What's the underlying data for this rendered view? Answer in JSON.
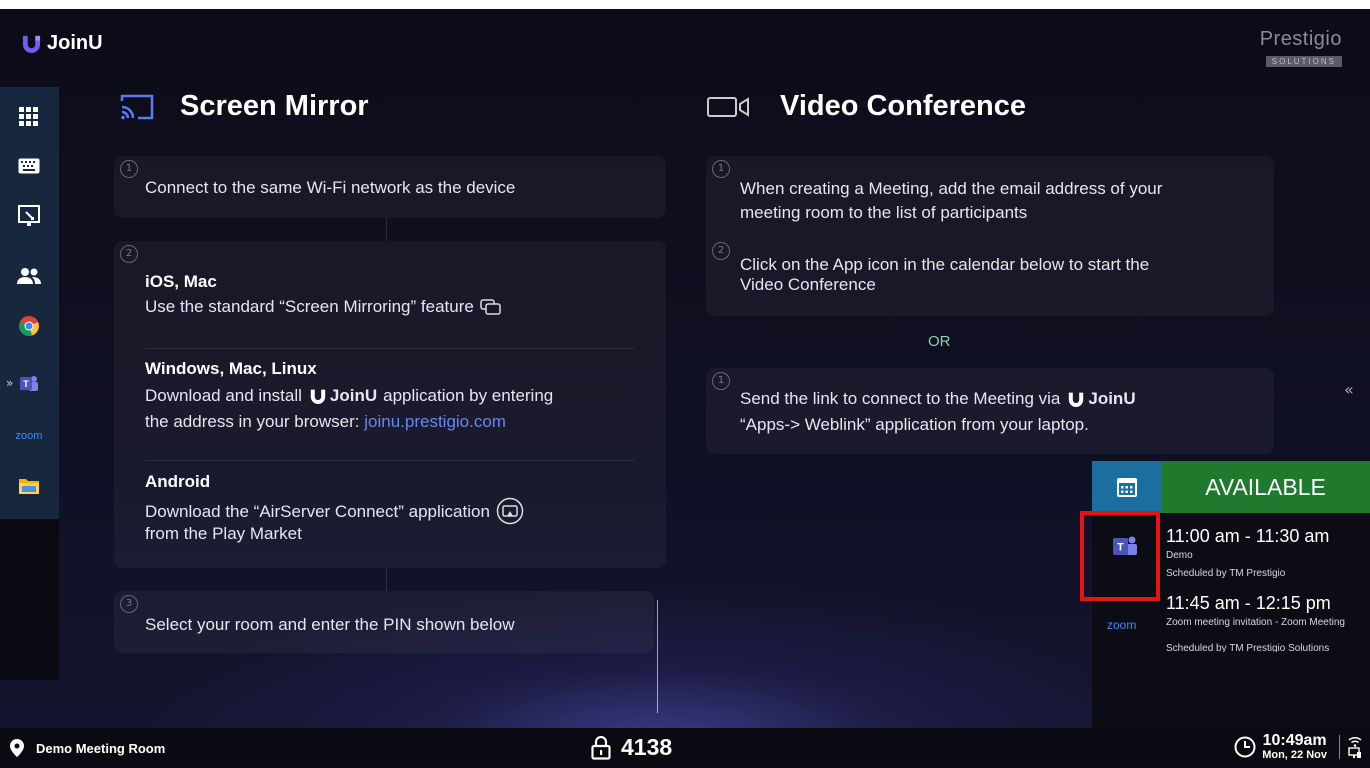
{
  "app": {
    "name": "JoinU"
  },
  "brand": {
    "line1": "Prestigio",
    "line2": "SOLUTIONS"
  },
  "sidebar": {
    "items": [
      {
        "icon": "apps-grid-icon"
      },
      {
        "icon": "keyboard-icon"
      },
      {
        "icon": "whiteboard-icon"
      },
      {
        "icon": "users-icon"
      },
      {
        "icon": "chrome-icon"
      },
      {
        "icon": "teams-icon"
      },
      {
        "icon": "zoom-icon",
        "label": "zoom"
      },
      {
        "icon": "folder-icon"
      }
    ]
  },
  "screen_mirror": {
    "title": "Screen Mirror",
    "step1": {
      "num": "1",
      "text": "Connect to the same Wi-Fi network as the device"
    },
    "step2": {
      "num": "2",
      "ios_title": "iOS, Mac",
      "ios_text": "Use the standard “Screen Mirroring” feature",
      "win_title": "Windows, Mac, Linux",
      "win_text1": "Download and install",
      "win_app": "JoinU",
      "win_text2": "application by entering",
      "win_text3": "the address in your browser:",
      "win_link": "joinu.prestigio.com",
      "android_title": "Android",
      "android_text1": "Download the “AirServer Connect” application",
      "android_text2": "from the Play Market"
    },
    "step3": {
      "num": "3",
      "text": "Select your room and enter the PIN shown below"
    }
  },
  "video_conference": {
    "title": "Video Conference",
    "step1": {
      "num": "1",
      "line1": "When creating a Meeting, add the email address of your",
      "line2": "meeting room to the list of participants"
    },
    "step2": {
      "num": "2",
      "line1": "Click on the App icon in the calendar below to start the",
      "line2": "Video Conference"
    },
    "or": "OR",
    "step3": {
      "num": "1",
      "line1": "Send the link to connect to the Meeting via",
      "app": "JoinU",
      "line2": "“Apps-> Weblink” application from your laptop."
    }
  },
  "calendar": {
    "status": "AVAILABLE",
    "events": [
      {
        "time": "11:00 am - 11:30 am",
        "title": "Demo",
        "organizer": "Scheduled by TM Prestigio",
        "app_icon": "teams-icon"
      },
      {
        "time": "11:45 am - 12:15 pm",
        "title": "Zoom meeting invitation - Zoom Meeting",
        "organizer": "Scheduled by TM Prestigio Solutions",
        "app_icon": "zoom-icon",
        "app_label": "zoom"
      }
    ]
  },
  "footer": {
    "room": "Demo Meeting Room",
    "pin": "4138",
    "time": "10:49am",
    "date": "Mon, 22 Nov"
  },
  "colors": {
    "accent_blue": "#6a86f0",
    "available_green": "#1f7a2e",
    "calendar_blue": "#1b6fa0",
    "highlight_red": "#e61414"
  }
}
